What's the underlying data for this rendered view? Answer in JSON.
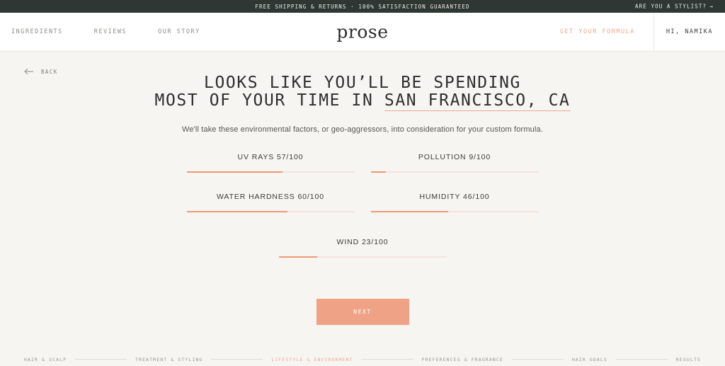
{
  "announcement": {
    "text": "FREE SHIPPING & RETURNS · 100% SATISFACTION GUARANTEED",
    "stylist_link": "ARE YOU A STYLIST?",
    "stylist_arrow": "→",
    "background": "#2e3733"
  },
  "header": {
    "nav": [
      {
        "label": "INGREDIENTS"
      },
      {
        "label": "REVIEWS"
      },
      {
        "label": "OUR STORY"
      }
    ],
    "logo": "prose",
    "cta_label": "GET YOUR FORMULA",
    "cta_color": "#f0a98f",
    "account_label": "HI, NAMIKA"
  },
  "back": {
    "label": "BACK",
    "icon": "arrow-left-icon"
  },
  "headline": {
    "line1": "LOOKS LIKE YOU’LL BE SPENDING",
    "line2_prefix": "MOST OF YOUR TIME IN ",
    "city": "SAN FRANCISCO, CA",
    "underline_color": "#f0a98f"
  },
  "subheadline": "We'll take these environmental factors, or geo-aggressors, into consideration for your custom formula.",
  "chart_data": {
    "type": "bar",
    "title": "Geo-aggressor scores",
    "categories": [
      "UV RAYS",
      "POLLUTION",
      "WATER HARDNESS",
      "HUMIDITY",
      "WIND"
    ],
    "values": [
      57,
      9,
      60,
      46,
      23
    ],
    "max": 100,
    "unit": "/100",
    "xlabel": "",
    "ylabel": "",
    "ylim": [
      0,
      100
    ],
    "grid": false,
    "legend": false,
    "fill_color": "#ef9876",
    "track_color": "#f8e2da"
  },
  "metrics": [
    {
      "name": "UV RAYS",
      "label": "UV RAYS 57/100",
      "value": 57,
      "max": 100,
      "pct": "57%"
    },
    {
      "name": "POLLUTION",
      "label": "POLLUTION 9/100",
      "value": 9,
      "max": 100,
      "pct": "9%"
    },
    {
      "name": "WATER HARDNESS",
      "label": "WATER HARDNESS 60/100",
      "value": 60,
      "max": 100,
      "pct": "60%"
    },
    {
      "name": "HUMIDITY",
      "label": "HUMIDITY 46/100",
      "value": 46,
      "max": 100,
      "pct": "46%"
    },
    {
      "name": "WIND",
      "label": "WIND 23/100",
      "value": 23,
      "max": 100,
      "pct": "23%"
    }
  ],
  "next_button": {
    "label": "NEXT",
    "color": "#f0a287"
  },
  "steps": [
    {
      "label": "HAIR & SCALP",
      "active": false
    },
    {
      "label": "TREATMENT & STYLING",
      "active": false
    },
    {
      "label": "LIFESTYLE & ENVIRONMENT",
      "active": true
    },
    {
      "label": "PREFERENCES & FRAGRANCE",
      "active": false
    },
    {
      "label": "HAIR GOALS",
      "active": false
    },
    {
      "label": "RESULTS",
      "active": false
    }
  ]
}
